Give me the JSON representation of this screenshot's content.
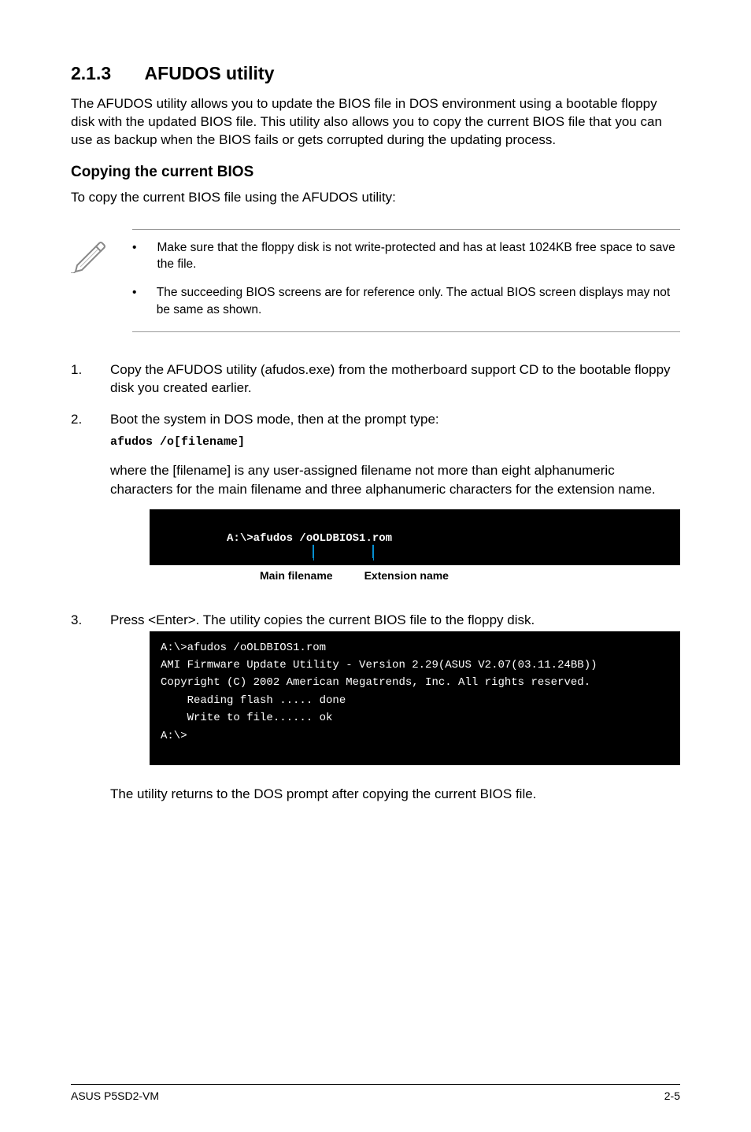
{
  "heading": {
    "number": "2.1.3",
    "title": "AFUDOS utility"
  },
  "intro": "The AFUDOS utility allows you to update the BIOS file in DOS environment using a bootable floppy disk with the updated BIOS file. This utility also allows you to copy the current BIOS file that you can use as backup when the BIOS fails or gets corrupted during the updating process.",
  "sub1": {
    "title": "Copying the current BIOS",
    "intro": "To copy the current BIOS file using the AFUDOS utility:"
  },
  "note": {
    "items": [
      "Make sure that the floppy disk is not write-protected and has at least 1024KB free space to save the file.",
      "The succeeding BIOS screens are for reference only. The actual BIOS screen displays may not be same as shown."
    ]
  },
  "steps": {
    "s1": {
      "num": "1.",
      "text": "Copy the AFUDOS utility (afudos.exe) from the motherboard support CD to the bootable floppy disk you created earlier."
    },
    "s2": {
      "num": "2.",
      "text": "Boot the system in DOS mode, then at the prompt type:",
      "code": "afudos /o[filename]",
      "where": "where the [filename] is any user-assigned filename not more than eight alphanumeric characters  for the main filename and three alphanumeric characters for the extension name."
    },
    "s3": {
      "num": "3.",
      "text": "Press <Enter>. The utility copies the current BIOS file to the floppy disk."
    }
  },
  "term1": {
    "prefix": "A:\\>afudos /o",
    "main": "OLDBIOS1",
    "dot": ".",
    "ext": "rom"
  },
  "labels": {
    "main": "Main filename",
    "ext": "Extension name"
  },
  "term2": {
    "l1": "A:\\>afudos /oOLDBIOS1.rom",
    "l2": "AMI Firmware Update Utility - Version 2.29(ASUS V2.07(03.11.24BB))",
    "l3": "Copyright (C) 2002 American Megatrends, Inc. All rights reserved.",
    "l4": "    Reading flash ..... done",
    "l5": "    Write to file...... ok",
    "l6": "A:\\>"
  },
  "closing": "The utility returns to the DOS prompt after copying the current BIOS file.",
  "footer": {
    "left": "ASUS P5SD2-VM",
    "right": "2-5"
  }
}
